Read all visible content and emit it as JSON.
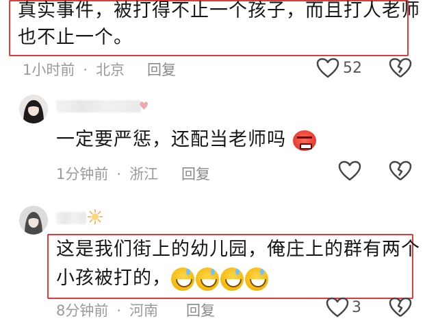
{
  "comment1": {
    "text_line1": "真实事件，被打得不止一个孩子，而且打人老师",
    "text_line2": "也不止一个。",
    "time": "1小时前",
    "location": "北京",
    "reply_label": "回复",
    "like_count": "52"
  },
  "comment2": {
    "text": "一定要严惩，还配当老师吗",
    "emoji": "angry-face-emoji",
    "time": "1分钟前",
    "location": "浙江",
    "reply_label": "回复"
  },
  "comment3": {
    "text_line1": "这是我们街上的幼儿园，俺庄上的群有两个",
    "text_line2": "小孩被打的，",
    "emojis": [
      "grinning-sweat-emoji",
      "grinning-sweat-emoji",
      "grinning-sweat-emoji",
      "grinning-sweat-emoji"
    ],
    "time": "8分钟前",
    "location": "河南",
    "reply_label": "回复",
    "like_count": "3"
  },
  "colors": {
    "highlight_box": "#e03a3a",
    "meta_text": "#9a9a9a"
  },
  "separator": "·"
}
